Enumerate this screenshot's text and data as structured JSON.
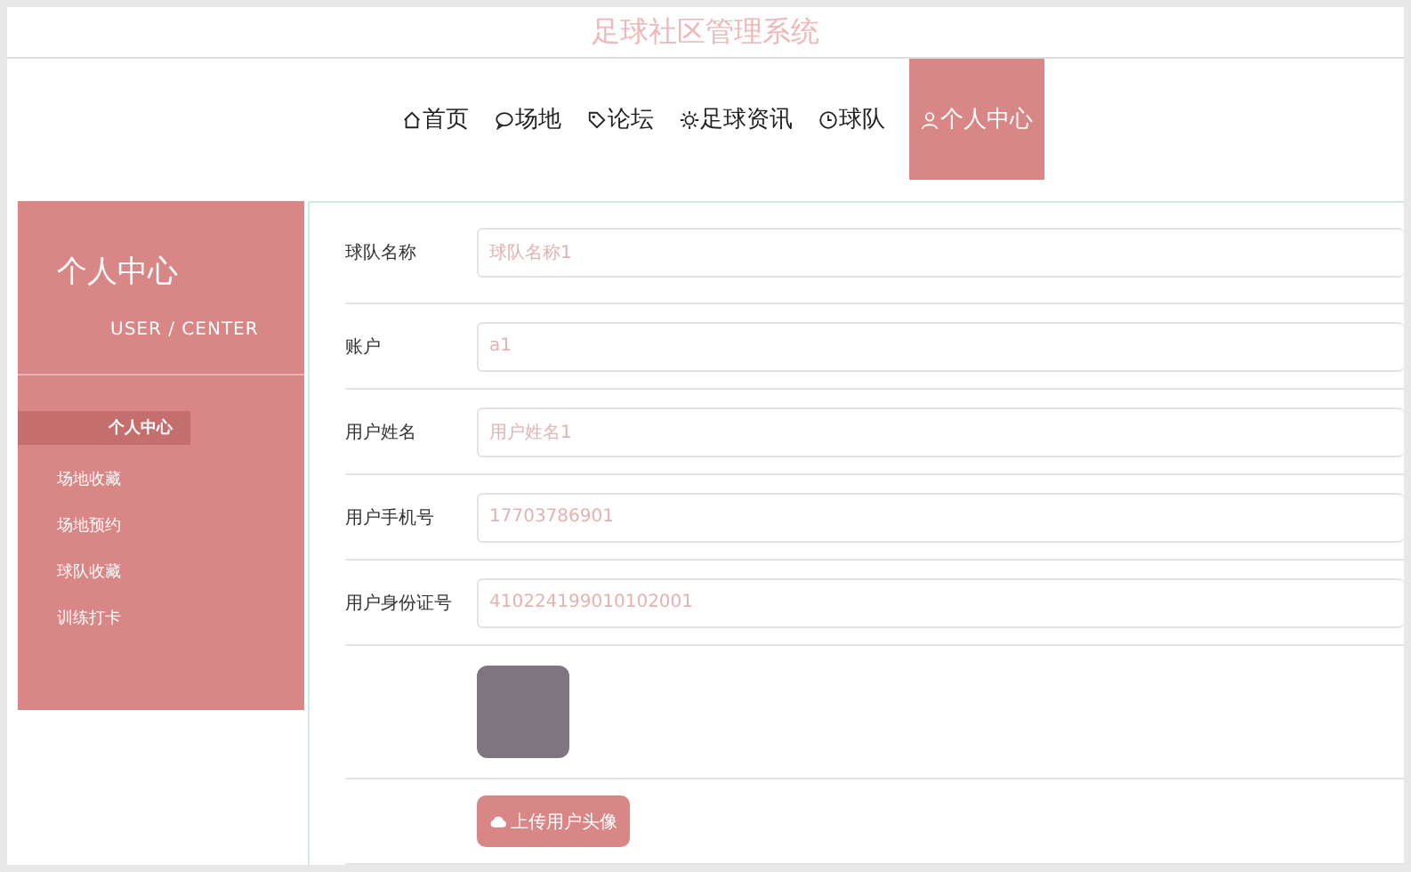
{
  "header": {
    "title": "足球社区管理系统"
  },
  "nav": [
    {
      "label": "首页",
      "selected": false
    },
    {
      "label": "场地",
      "selected": false
    },
    {
      "label": "论坛",
      "selected": false
    },
    {
      "label": "足球资讯",
      "selected": false
    },
    {
      "label": "球队",
      "selected": false
    },
    {
      "label": "个人中心",
      "selected": true
    }
  ],
  "sidebar": {
    "title": "个人中心",
    "subtitle": "USER / CENTER",
    "items": [
      {
        "label": "个人中心",
        "selected": true
      },
      {
        "label": "场地收藏",
        "selected": false
      },
      {
        "label": "场地预约",
        "selected": false
      },
      {
        "label": "球队收藏",
        "selected": false
      },
      {
        "label": "训练打卡",
        "selected": false
      }
    ]
  },
  "form": {
    "fields": [
      {
        "label": "球队名称",
        "value": "球队名称1"
      },
      {
        "label": "账户",
        "value": "a1"
      },
      {
        "label": "用户姓名",
        "value": "用户姓名1"
      },
      {
        "label": "用户手机号",
        "value": "17703786901"
      },
      {
        "label": "用户身份证号",
        "value": "410224199010102001"
      }
    ],
    "upload_button": "上传用户头像"
  }
}
